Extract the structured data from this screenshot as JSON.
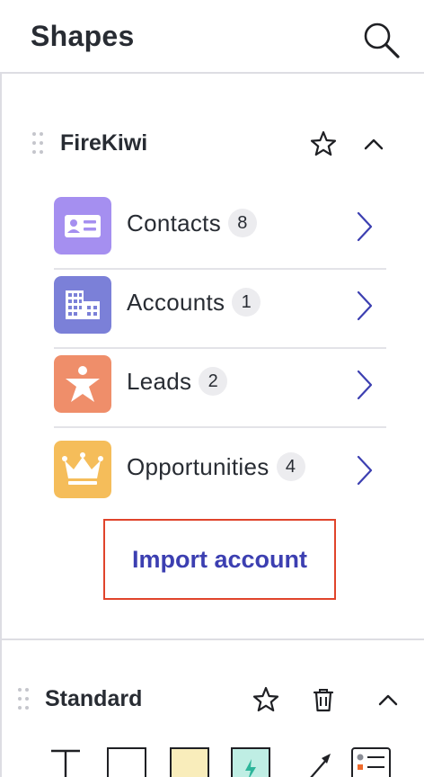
{
  "header": {
    "title": "Shapes"
  },
  "firekiwi": {
    "title": "FireKiwi",
    "items": [
      {
        "label": "Contacts",
        "count": "8",
        "icon": "contact-card-icon",
        "color": "#a58ff0"
      },
      {
        "label": "Accounts",
        "count": "1",
        "icon": "building-icon",
        "color": "#7b80d8"
      },
      {
        "label": "Leads",
        "count": "2",
        "icon": "person-icon",
        "color": "#ef8e6a"
      },
      {
        "label": "Opportunities",
        "count": "4",
        "icon": "crown-icon",
        "color": "#f5bd5a"
      }
    ],
    "import_label": "Import account"
  },
  "standard": {
    "title": "Standard",
    "tools": [
      "text-tool-icon",
      "rectangle-tool-icon",
      "sticky-note-icon",
      "action-shape-icon",
      "arrow-tool-icon",
      "card-shape-icon"
    ]
  },
  "colors": {
    "accent": "#3c3fb1",
    "highlight_border": "#e0442b",
    "chevron": "#3c3fb1",
    "divider": "#dddde3"
  }
}
